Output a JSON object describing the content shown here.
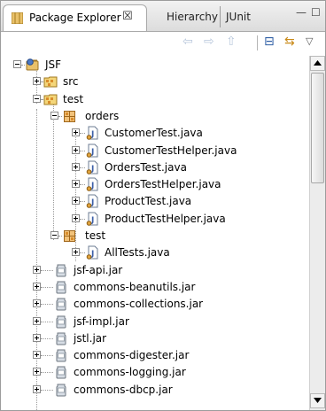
{
  "tabs": {
    "active_label": "Package Explorer",
    "close_glyph": "☒",
    "others": [
      {
        "label": "Hierarchy"
      },
      {
        "label": "JUnit"
      }
    ],
    "minimize_glyph": "—",
    "maximize_glyph": "☐"
  },
  "toolbar": {
    "back_glyph": "⇦",
    "forward_glyph": "⇨",
    "up_glyph": "⇧",
    "collapse_all_glyph": "⊟",
    "link_editor_glyph": "⇆",
    "view_menu_glyph": "▽"
  },
  "tree": [
    {
      "label": "JSF",
      "icon": "project-icon",
      "state": "expanded"
    },
    {
      "label": "src",
      "icon": "source-folder-icon",
      "state": "collapsed"
    },
    {
      "label": "test",
      "icon": "source-folder-icon",
      "state": "expanded"
    },
    {
      "label": "orders",
      "icon": "package-icon",
      "state": "expanded"
    },
    {
      "label": "CustomerTest.java",
      "icon": "java-file-icon",
      "state": "collapsed"
    },
    {
      "label": "CustomerTestHelper.java",
      "icon": "java-file-icon",
      "state": "collapsed"
    },
    {
      "label": "OrdersTest.java",
      "icon": "java-file-icon",
      "state": "collapsed"
    },
    {
      "label": "OrdersTestHelper.java",
      "icon": "java-file-icon",
      "state": "collapsed"
    },
    {
      "label": "ProductTest.java",
      "icon": "java-file-icon",
      "state": "collapsed"
    },
    {
      "label": "ProductTestHelper.java",
      "icon": "java-file-icon",
      "state": "collapsed"
    },
    {
      "label": "test",
      "icon": "package-icon",
      "state": "expanded"
    },
    {
      "label": "AllTests.java",
      "icon": "java-file-icon",
      "state": "collapsed"
    },
    {
      "label": "jsf-api.jar",
      "icon": "jar-icon",
      "state": "collapsed"
    },
    {
      "label": "commons-beanutils.jar",
      "icon": "jar-icon",
      "state": "collapsed"
    },
    {
      "label": "commons-collections.jar",
      "icon": "jar-icon",
      "state": "collapsed"
    },
    {
      "label": "jsf-impl.jar",
      "icon": "jar-icon",
      "state": "collapsed"
    },
    {
      "label": "jstl.jar",
      "icon": "jar-icon",
      "state": "collapsed"
    },
    {
      "label": "commons-digester.jar",
      "icon": "jar-icon",
      "state": "collapsed"
    },
    {
      "label": "commons-logging.jar",
      "icon": "jar-icon",
      "state": "collapsed"
    },
    {
      "label": "commons-dbcp.jar",
      "icon": "jar-icon",
      "state": "collapsed"
    }
  ],
  "colors": {
    "source_folder": "#c9a227",
    "package": "#d98c2b",
    "java_file": "#3b5fa8",
    "jar": "#d7dde5",
    "project": "#4a79c5"
  }
}
